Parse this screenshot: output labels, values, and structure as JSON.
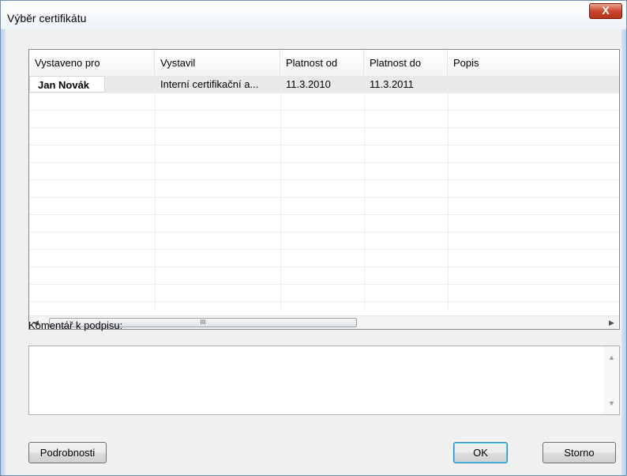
{
  "window": {
    "title": "Výběr certifikátu",
    "close_glyph": "X"
  },
  "table": {
    "columns": [
      "Vystaveno pro",
      "Vystavil",
      "Platnost od",
      "Platnost do",
      "Popis"
    ],
    "rows": [
      {
        "issued_to": "Jan Novák",
        "issuer": "Interní certifikační a...",
        "valid_from": "11.3.2010",
        "valid_to": "11.3.2011",
        "description": ""
      }
    ]
  },
  "scrollbar": {
    "thumb_grip": "III",
    "left_arrow": "◀",
    "right_arrow": "▶"
  },
  "comment": {
    "label": "Komentář k podpisu:",
    "value": ""
  },
  "buttons": {
    "details": "Podrobnosti",
    "ok": "OK",
    "cancel": "Storno"
  },
  "colors": {
    "selected_row": "#e9e9e9",
    "close_button": "#c9472c"
  }
}
